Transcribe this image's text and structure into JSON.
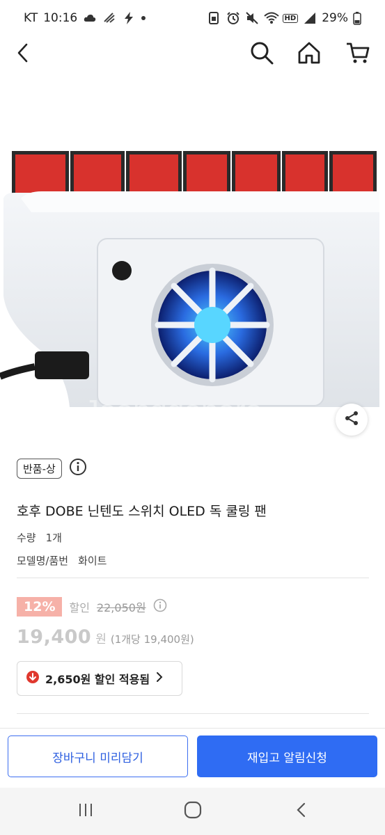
{
  "status_bar": {
    "carrier": "KT",
    "time": "10:16",
    "battery": "29%",
    "hd_badge": "HD",
    "icons": [
      "cloud-icon",
      "signal-low-icon",
      "bolt-icon",
      "dot-icon",
      "sim-icon",
      "alarm-icon",
      "mute-icon",
      "wifi-icon",
      "hd-icon",
      "signal-icon",
      "battery-icon"
    ]
  },
  "nav": {
    "icons": [
      "back-icon",
      "search-icon",
      "home-icon",
      "cart-icon"
    ]
  },
  "product": {
    "image_alt_icon": "cooling-fan-product-photo",
    "condition_badge": "반품-상",
    "title": "호후 DOBE 닌텐도 스위치 OLED 독 쿨링 팬",
    "specs": [
      {
        "label": "수량",
        "value": "1개"
      },
      {
        "label": "모델명/품번",
        "value": "화이트"
      }
    ]
  },
  "price": {
    "discount_rate": "12%",
    "discount_label": "할인",
    "original_price": "22,050원",
    "final_price": "19,400",
    "final_unit": "원",
    "unit_price": "(1개당 19,400원)",
    "coupon_text": "2,650원 할인 적용됨"
  },
  "actions": {
    "cart_label": "장바구니 미리담기",
    "restock_label": "재입고 알림신청"
  },
  "colors": {
    "primary": "#2f6cf3",
    "discount_badge": "#f6b1a8",
    "coupon_icon": "#e0382e"
  }
}
